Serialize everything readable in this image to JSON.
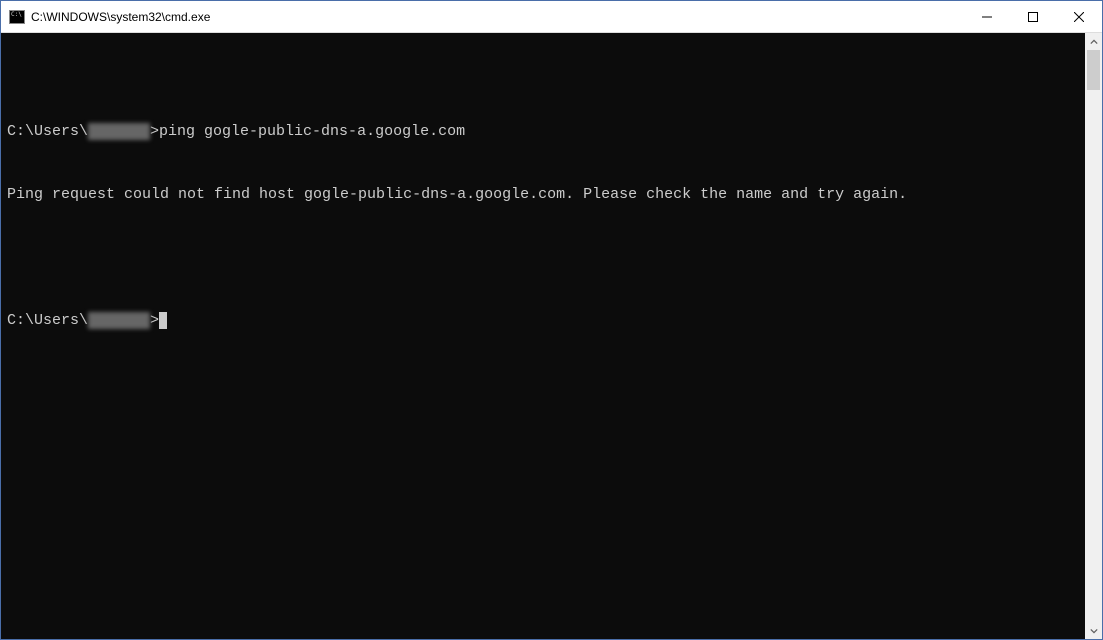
{
  "window": {
    "title": "C:\\WINDOWS\\system32\\cmd.exe"
  },
  "terminal": {
    "prompt_prefix": "C:\\Users\\",
    "prompt_suffix": ">",
    "command": "ping gogle-public-dns-a.google.com",
    "output_line": "Ping request could not find host gogle-public-dns-a.google.com. Please check the name and try again.",
    "redacted_user": "██████"
  }
}
